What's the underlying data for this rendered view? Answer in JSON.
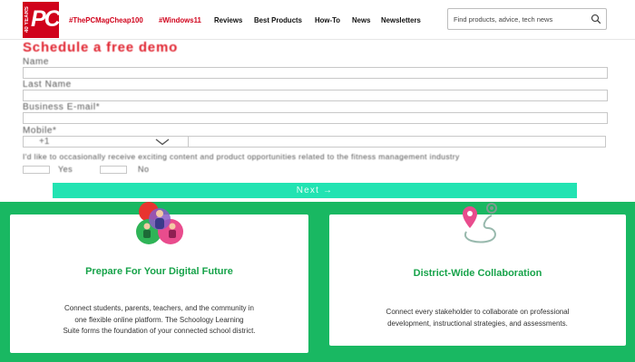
{
  "header": {
    "logo": {
      "years": "40 YEARS",
      "text": "PC"
    },
    "nav": [
      {
        "label": "#ThePCMagCheap100",
        "highlight": true
      },
      {
        "label": "#Windows11",
        "highlight": true
      },
      {
        "label": "Reviews",
        "highlight": false
      },
      {
        "label": "Best Products",
        "highlight": false
      },
      {
        "label": "How-To",
        "highlight": false
      },
      {
        "label": "News",
        "highlight": false
      },
      {
        "label": "Newsletters",
        "highlight": false
      }
    ],
    "search": {
      "placeholder": "Find products, advice, tech news"
    }
  },
  "form": {
    "title": "Schedule a free demo",
    "fields": [
      {
        "label": "Name",
        "value": ""
      },
      {
        "label": "Last Name",
        "value": ""
      },
      {
        "label": "Business E-mail*",
        "value": ""
      }
    ],
    "mobile": {
      "label": "Mobile*",
      "country_code": "+1",
      "value": ""
    },
    "consent_text": "I'd like to occasionally receive exciting content and product opportunities related to the fitness management industry",
    "consent_options": [
      "Yes",
      "No"
    ],
    "next_label": "Next →"
  },
  "cards": [
    {
      "title": "Prepare For Your Digital Future",
      "lines": [
        "Connect students, parents, teachers, and the community in",
        "one flexible online platform. The Schoology Learning",
        "Suite forms the foundation of your connected school district."
      ]
    },
    {
      "title": "District-Wide Collaboration",
      "lines": [
        "Connect every stakeholder to collaborate on professional",
        "development, instructional strategies, and assessments."
      ]
    }
  ],
  "colors": {
    "brand_red": "#d0021b",
    "form_title_red": "#e0232f",
    "next_button": "#22e3b2",
    "section_green": "#19b862",
    "card_title_green": "#17a34a"
  }
}
